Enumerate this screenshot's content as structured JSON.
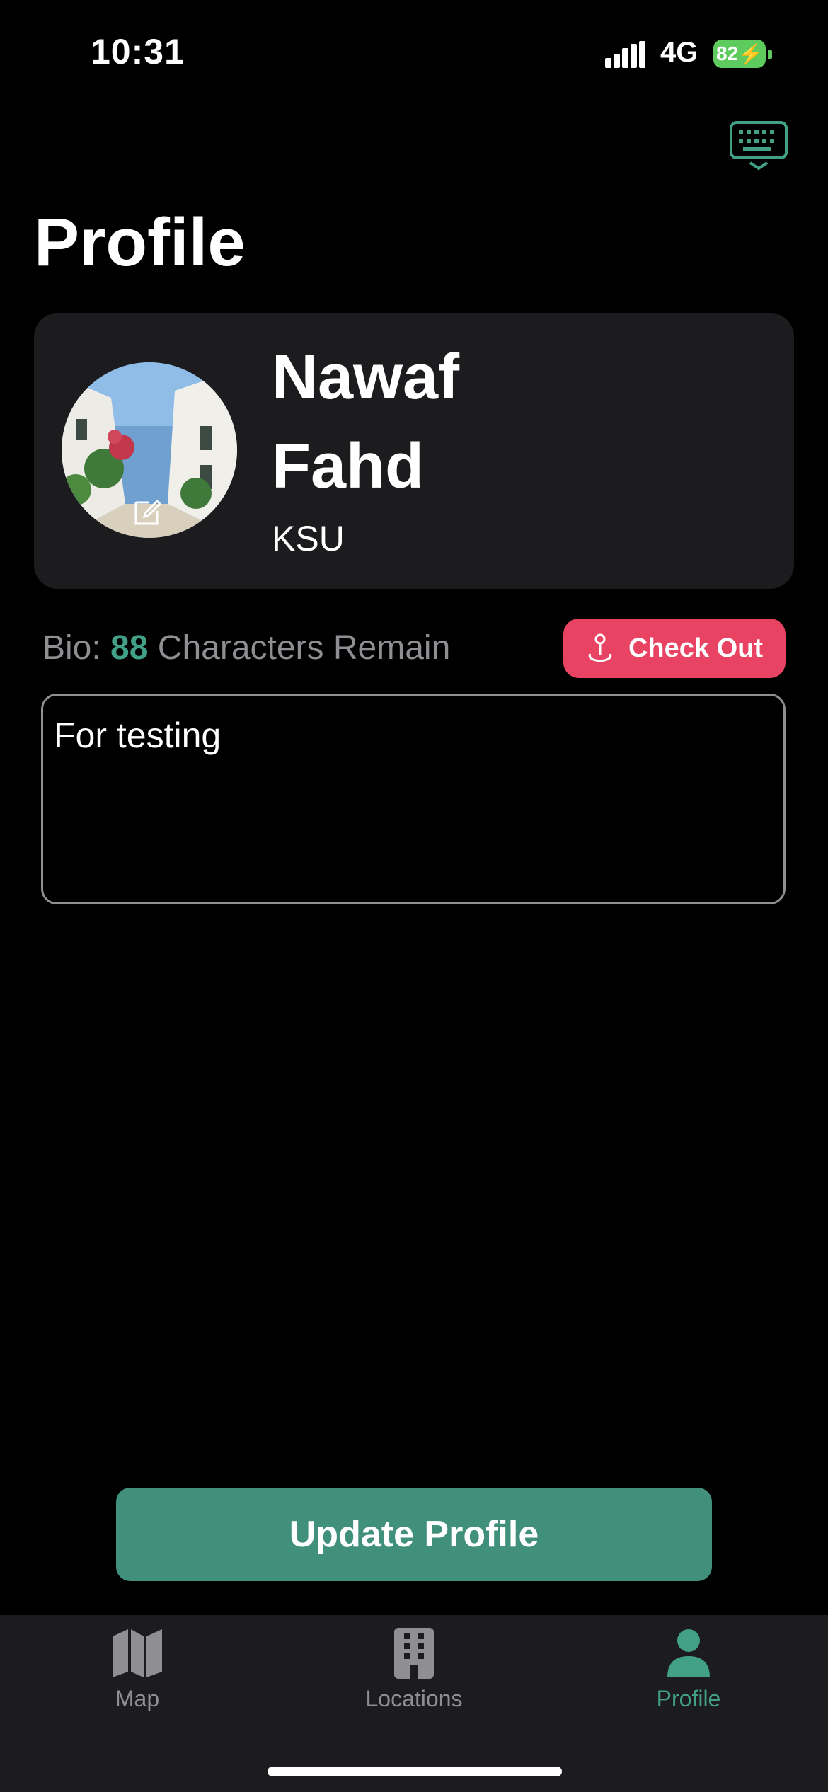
{
  "status_bar": {
    "time": "10:31",
    "network": "4G",
    "battery": "82"
  },
  "page": {
    "title": "Profile"
  },
  "profile": {
    "first_name": "Nawaf",
    "last_name": "Fahd",
    "organization": "KSU"
  },
  "bio": {
    "prefix": "Bio: ",
    "remaining": "88",
    "suffix": " Characters Remain",
    "text": "For testing"
  },
  "checkout_button": {
    "label": "Check Out"
  },
  "update_button": {
    "label": "Update Profile"
  },
  "tabs": [
    {
      "label": "Map",
      "icon": "map-icon",
      "active": false
    },
    {
      "label": "Locations",
      "icon": "building-icon",
      "active": false
    },
    {
      "label": "Profile",
      "icon": "person-icon",
      "active": true
    }
  ],
  "colors": {
    "accent": "#41a085",
    "checkout": "#e84362",
    "inactive_tab": "#8e8e93",
    "battery": "#5ecb5f"
  }
}
